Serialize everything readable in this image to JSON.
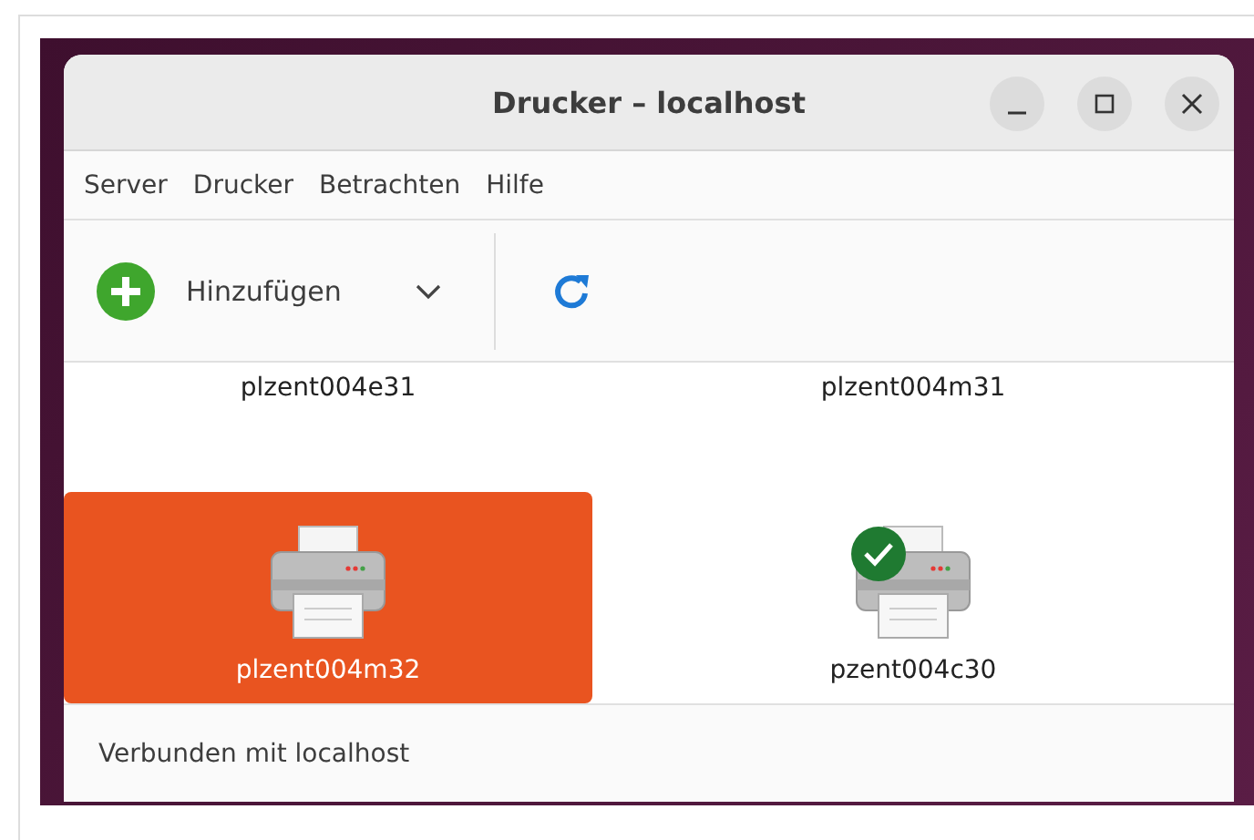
{
  "window": {
    "title": "Drucker – localhost"
  },
  "menu": [
    "Server",
    "Drucker",
    "Betrachten",
    "Hilfe"
  ],
  "toolbar": {
    "add_button": "Hinzufügen"
  },
  "printers": [
    {
      "name": "plzent004e31",
      "kind": "label",
      "selected": false
    },
    {
      "name": "plzent004m31",
      "kind": "label",
      "selected": false
    },
    {
      "name": "plzent004m32",
      "kind": "icon",
      "selected": true,
      "default": false
    },
    {
      "name": "pzent004c30",
      "kind": "icon",
      "selected": false,
      "default": true
    }
  ],
  "status_bar": "Verbunden mit localhost"
}
